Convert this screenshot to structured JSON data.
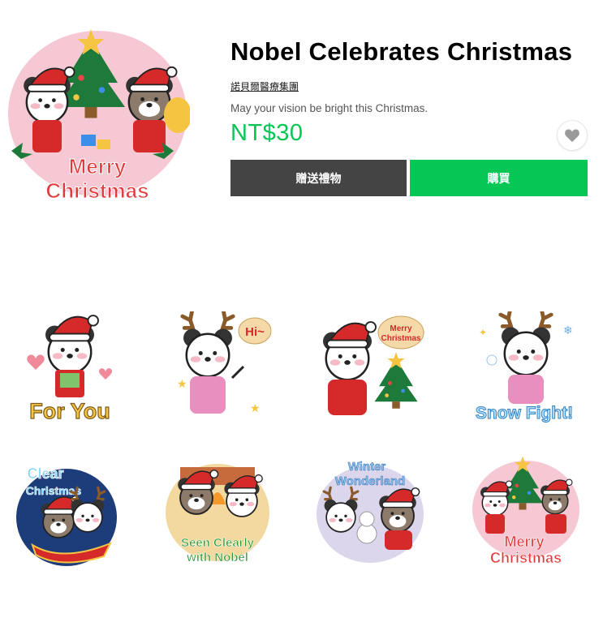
{
  "product": {
    "title": "Nobel Celebrates Christmas",
    "author": "諾貝爾醫療集團",
    "description": "May your vision be bright this Christmas.",
    "price": "NT$30",
    "cover_text": [
      "Merry",
      "Christmas"
    ]
  },
  "actions": {
    "gift_label": "贈送禮物",
    "buy_label": "購買"
  },
  "stickers": [
    {
      "id": "for-you",
      "text": [
        "For You"
      ]
    },
    {
      "id": "hi",
      "text": [
        "Hi~"
      ]
    },
    {
      "id": "merry-christmas-bubble",
      "text": [
        "Merry",
        "Christmas"
      ]
    },
    {
      "id": "snow-fight",
      "text": [
        "Snow Fight!"
      ]
    },
    {
      "id": "clear-christmas",
      "text": [
        "Clear",
        "Christmas"
      ]
    },
    {
      "id": "seen-clearly",
      "text": [
        "Seen Clearly",
        "with Nobel"
      ]
    },
    {
      "id": "winter-wonderland",
      "text": [
        "Winter",
        "Wonderland"
      ]
    },
    {
      "id": "merry-christmas",
      "text": [
        "Merry",
        "Christmas"
      ]
    }
  ],
  "colors": {
    "brand_green": "#06c755",
    "gift_gray": "#444444",
    "price_green": "#06c755",
    "santa_red": "#d62a2a"
  }
}
